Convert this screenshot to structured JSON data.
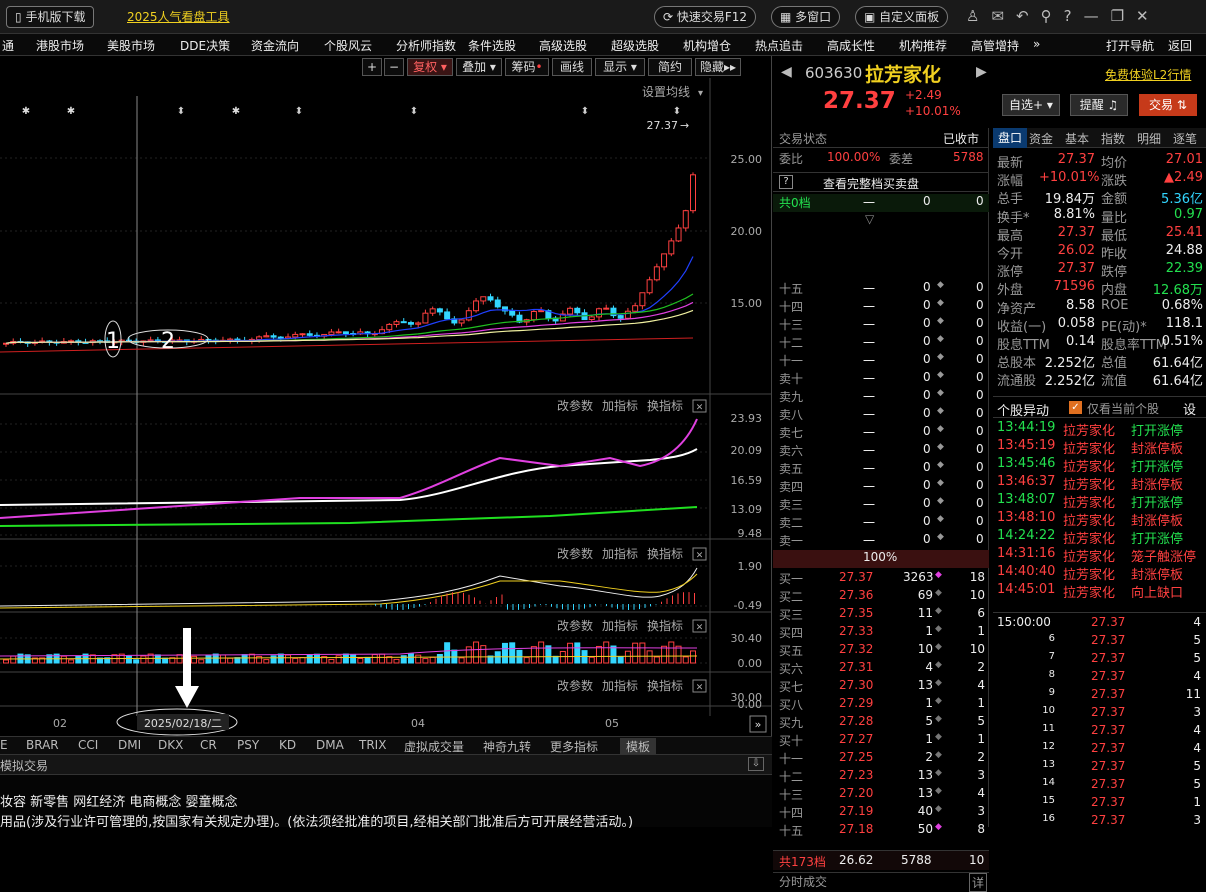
{
  "topbar": {
    "mobile": "手机版下载",
    "promo": "2025人气看盘工具",
    "quick_trade": "快速交易F12",
    "multi_window": "多窗口",
    "custom_panel": "自定义面板"
  },
  "nav": [
    "通",
    "港股市场",
    "美股市场",
    "DDE决策",
    "资金流向",
    "个股风云",
    "分析师指数",
    "条件选股",
    "高级选股",
    "超级选股",
    "机构增仓",
    "热点追击",
    "高成长性",
    "机构推荐",
    "高管增持",
    "»",
    "打开导航",
    "返回"
  ],
  "toolbar": {
    "fuquan": "复权",
    "diejia": "叠加",
    "chouma": "筹码",
    "huaxian": "画线",
    "xianshi": "显示",
    "jianyue": "简约",
    "yincang": "隐藏"
  },
  "kline": {
    "setting": "设置均线",
    "last_price_label": "27.37",
    "yaxis": [
      "25.00",
      "20.00",
      "15.00"
    ],
    "stars": [
      "*",
      "*",
      "*"
    ],
    "markers": [
      "1",
      "2"
    ]
  },
  "ind_buttons": [
    "改参数",
    "加指标",
    "换指标"
  ],
  "ind1": {
    "yaxis": [
      "23.93",
      "20.09",
      "16.59",
      "13.09",
      "9.48"
    ]
  },
  "ind2": {
    "yaxis": [
      "1.90",
      "-0.49"
    ]
  },
  "ind3": {
    "yaxis": [
      "30.40",
      "0.00"
    ]
  },
  "ind4": {
    "yaxis": [
      "30.00",
      "0.00"
    ]
  },
  "xaxis": {
    "labels": [
      "02",
      "04",
      "05"
    ],
    "cursor_date": "2025/02/18/二"
  },
  "bottom_tabs": [
    "E",
    "BRAR",
    "CCI",
    "DMI",
    "DKX",
    "CR",
    "PSY",
    "KD",
    "DMA",
    "TRIX",
    "虚拟成交量",
    "神奇九转",
    "更多指标",
    "模板"
  ],
  "info": {
    "sim_trade": "模拟交易",
    "concepts": "妆容 新零售 网红经济 电商概念 婴童概念",
    "scope": "用品(涉及行业许可管理的,按国家有关规定办理)。(依法须经批准的项目,经相关部门批准后方可开展经营活动。)"
  },
  "stock": {
    "code": "603630",
    "name": "拉芳家化",
    "free_l2": "免费体验L2行情",
    "price": "27.37",
    "change": "+2.49",
    "pct": "+10.01%",
    "btn_zixuan": "自选+",
    "btn_tixing": "提醒",
    "btn_jiaoyi": "交易"
  },
  "trade_state": {
    "label": "交易状态",
    "value": "已收市",
    "weibi_label": "委比",
    "weibi": "100.00%",
    "weicha_label": "委差",
    "weicha": "5788",
    "full_book": "查看完整档买卖盘",
    "gong0": "共0档",
    "dash": "一"
  },
  "sell_levels": [
    "十五",
    "十四",
    "十三",
    "十二",
    "十一",
    "卖十",
    "卖九",
    "卖八",
    "卖七",
    "卖六",
    "卖五",
    "卖四",
    "卖三",
    "卖二",
    "卖一"
  ],
  "mid_pct": "100%",
  "buy_levels": [
    {
      "n": "买一",
      "p": "27.37",
      "v": "3263",
      "c": "18"
    },
    {
      "n": "买二",
      "p": "27.36",
      "v": "69",
      "c": "10"
    },
    {
      "n": "买三",
      "p": "27.35",
      "v": "11",
      "c": "6"
    },
    {
      "n": "买四",
      "p": "27.33",
      "v": "1",
      "c": "1"
    },
    {
      "n": "买五",
      "p": "27.32",
      "v": "10",
      "c": "10"
    },
    {
      "n": "买六",
      "p": "27.31",
      "v": "4",
      "c": "2"
    },
    {
      "n": "买七",
      "p": "27.30",
      "v": "13",
      "c": "4"
    },
    {
      "n": "买八",
      "p": "27.29",
      "v": "1",
      "c": "1"
    },
    {
      "n": "买九",
      "p": "27.28",
      "v": "5",
      "c": "5"
    },
    {
      "n": "买十",
      "p": "27.27",
      "v": "1",
      "c": "1"
    },
    {
      "n": "十一",
      "p": "27.25",
      "v": "2",
      "c": "2"
    },
    {
      "n": "十二",
      "p": "27.23",
      "v": "13",
      "c": "3"
    },
    {
      "n": "十三",
      "p": "27.20",
      "v": "13",
      "c": "4"
    },
    {
      "n": "十四",
      "p": "27.19",
      "v": "40",
      "c": "3"
    },
    {
      "n": "十五",
      "p": "27.18",
      "v": "50",
      "c": "8"
    }
  ],
  "buy_total": {
    "label": "共173档",
    "p": "26.62",
    "v": "5788",
    "c": "10"
  },
  "fenshi": "分时成交",
  "tabs": [
    "盘口",
    "资金",
    "基本",
    "指数",
    "明细",
    "逐笔"
  ],
  "quote": [
    [
      "最新",
      "27.37",
      "均价",
      "27.01"
    ],
    [
      "涨幅",
      "+10.01%",
      "涨跌",
      "▲2.49"
    ],
    [
      "总手",
      "19.84万",
      "金额",
      "5.36亿"
    ],
    [
      "换手*",
      "8.81%",
      "量比",
      "0.97"
    ],
    [
      "最高",
      "27.37",
      "最低",
      "25.41"
    ],
    [
      "今开",
      "26.02",
      "昨收",
      "24.88"
    ],
    [
      "涨停",
      "27.37",
      "跌停",
      "22.39"
    ],
    [
      "外盘",
      "71596",
      "内盘",
      "12.68万"
    ],
    [
      "净资产",
      "8.58",
      "ROE",
      "0.68%"
    ],
    [
      "收益(一)",
      "0.058",
      "PE(动)*",
      "118.1"
    ],
    [
      "股息TTM",
      "0.14",
      "股息率TTM",
      "0.51%"
    ],
    [
      "总股本",
      "2.252亿",
      "总值",
      "61.64亿"
    ],
    [
      "流通股",
      "2.252亿",
      "流值",
      "61.64亿"
    ]
  ],
  "movement": {
    "title": "个股异动",
    "only_current": "仅看当前个股",
    "settings": "设",
    "rows": [
      [
        "13:44:19",
        "拉芳家化",
        "打开涨停"
      ],
      [
        "13:45:19",
        "拉芳家化",
        "封涨停板"
      ],
      [
        "13:45:46",
        "拉芳家化",
        "打开涨停"
      ],
      [
        "13:46:37",
        "拉芳家化",
        "封涨停板"
      ],
      [
        "13:48:07",
        "拉芳家化",
        "打开涨停"
      ],
      [
        "13:48:10",
        "拉芳家化",
        "封涨停板"
      ],
      [
        "14:24:22",
        "拉芳家化",
        "打开涨停"
      ],
      [
        "14:31:16",
        "拉芳家化",
        "笼子触涨停"
      ],
      [
        "14:40:40",
        "拉芳家化",
        "封涨停板"
      ],
      [
        "14:45:01",
        "拉芳家化",
        "向上缺口"
      ]
    ]
  },
  "ticks": [
    [
      "15:00:00",
      "27.37",
      "4"
    ],
    [
      "6",
      "27.37",
      "5"
    ],
    [
      "7",
      "27.37",
      "5"
    ],
    [
      "8",
      "27.37",
      "4"
    ],
    [
      "9",
      "27.37",
      "11"
    ],
    [
      "10",
      "27.37",
      "3"
    ],
    [
      "11",
      "27.37",
      "4"
    ],
    [
      "12",
      "27.37",
      "4"
    ],
    [
      "13",
      "27.37",
      "5"
    ],
    [
      "14",
      "27.37",
      "5"
    ],
    [
      "15",
      "27.37",
      "1"
    ],
    [
      "16",
      "27.37",
      "3"
    ]
  ],
  "colors": {
    "up": "#ff4040",
    "down": "#23e04f",
    "cyan": "#33d6ff",
    "yellow": "#f0d020"
  }
}
